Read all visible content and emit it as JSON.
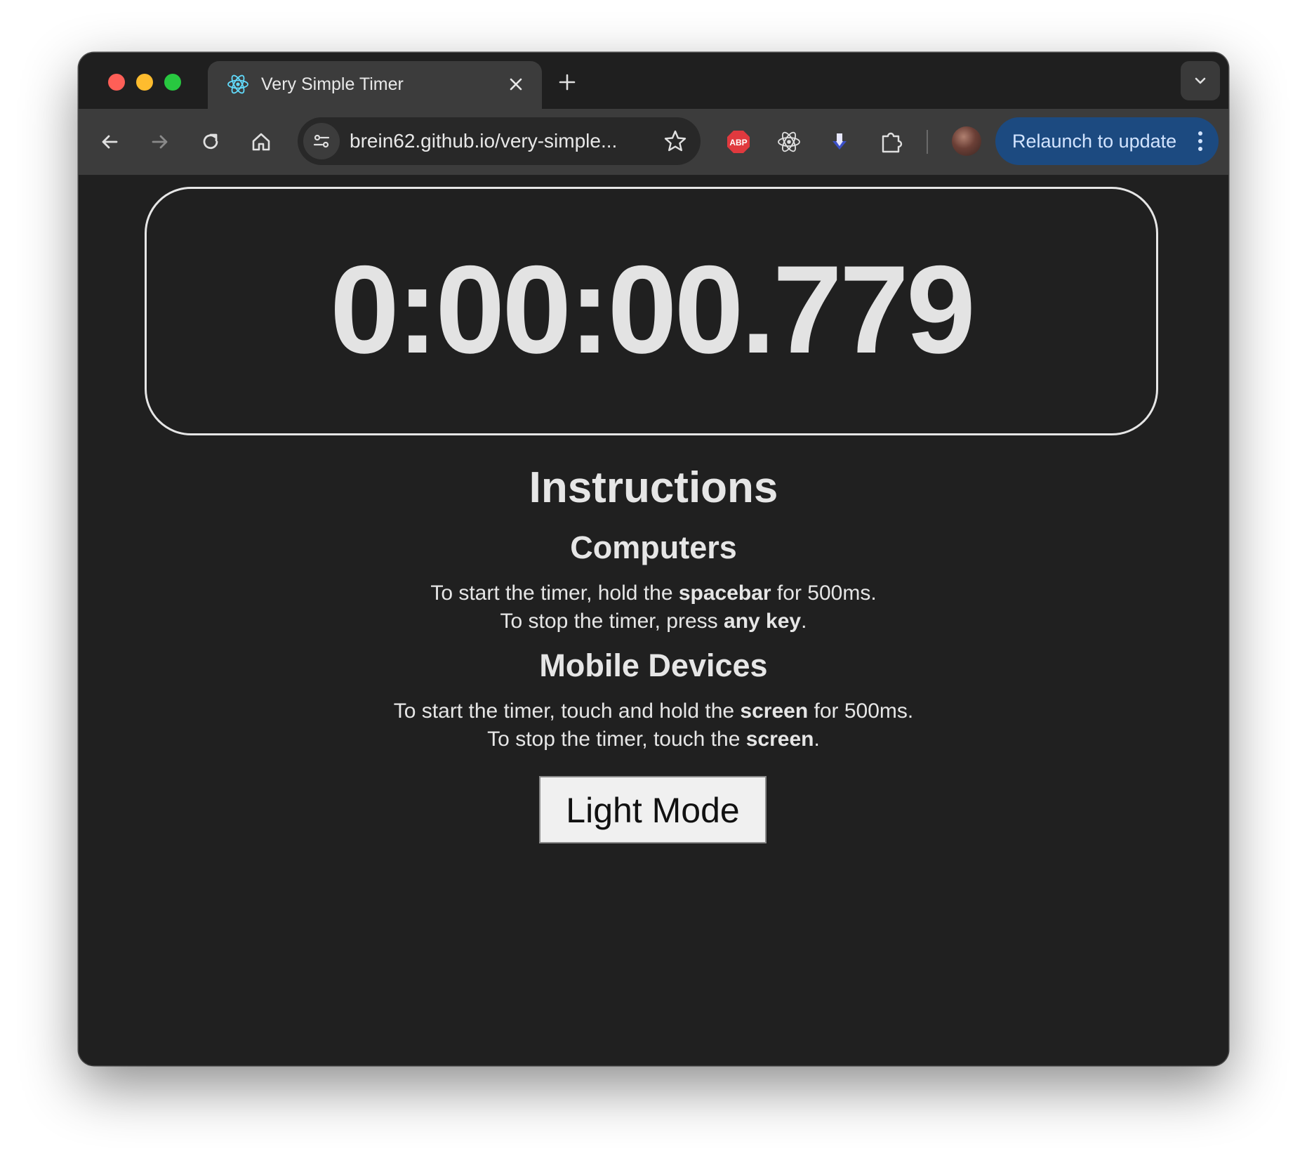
{
  "browser": {
    "tab": {
      "title": "Very Simple Timer",
      "favicon": "react-icon"
    },
    "omnibox": {
      "url": "brein62.github.io/very-simple..."
    },
    "relaunch_label": "Relaunch to update",
    "extensions": [
      "adblock-plus-icon",
      "react-devtools-icon",
      "download-arrow-icon",
      "puzzle-extensions-icon"
    ]
  },
  "page": {
    "timer": "0:00:00.779",
    "instructions_heading": "Instructions",
    "computers": {
      "heading": "Computers",
      "line1_a": "To start the timer, hold the ",
      "line1_b": "spacebar",
      "line1_c": " for 500ms.",
      "line2_a": "To stop the timer, press ",
      "line2_b": "any key",
      "line2_c": "."
    },
    "mobile": {
      "heading": "Mobile Devices",
      "line1_a": "To start the timer, touch and hold the ",
      "line1_b": "screen",
      "line1_c": " for 500ms.",
      "line2_a": "To stop the timer, touch the ",
      "line2_b": "screen",
      "line2_c": "."
    },
    "mode_button": "Light Mode"
  },
  "colors": {
    "page_background": "#202020",
    "text": "#e6e6e6",
    "relaunch_background": "#1c4a80",
    "abp_red": "#e0393e"
  }
}
